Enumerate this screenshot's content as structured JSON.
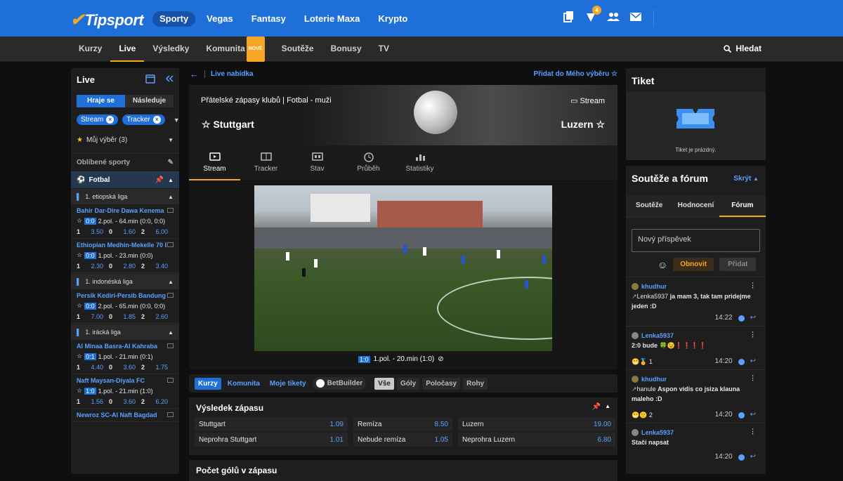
{
  "brand": {
    "name": "Tipsport"
  },
  "mainnav": [
    "Sporty",
    "Vegas",
    "Fantasy",
    "Loterie Maxa",
    "Krypto"
  ],
  "notif_count": "4",
  "subnav": [
    "Kurzy",
    "Live",
    "Výsledky",
    "Komunita",
    "Soutěže",
    "Bonusy",
    "TV"
  ],
  "nove": "NOVÉ",
  "search": "Hledat",
  "left": {
    "title": "Live",
    "seg": [
      "Hraje se",
      "Následuje"
    ],
    "chips": [
      "Stream",
      "Tracker"
    ],
    "muj": "Můj výběr (3)",
    "oblibene": "Oblíbené sporty",
    "sport": "Fotbal",
    "blocks": [
      {
        "league": "1. etiopská liga",
        "matches": [
          {
            "name": "Bahir Dar-Dire Dawa Kenema",
            "score": "0:0",
            "status": "2.pol. - 64.min (0:0, 0:0)",
            "o1": "3.50",
            "o0": "1.60",
            "o2": "6.00"
          },
          {
            "name": "Ethiopian Medhin-Mekelle 70 E...",
            "score": "0:0",
            "status": "1.pol. - 23.min (0:0)",
            "o1": "2.30",
            "o0": "2.80",
            "o2": "3.40"
          }
        ]
      },
      {
        "league": "1. indonéská liga",
        "matches": [
          {
            "name": "Persik Kediri-Persib Bandung",
            "score": "0:0",
            "status": "2.pol. - 65.min (0:0, 0:0)",
            "o1": "7.00",
            "o0": "1.85",
            "o2": "2.60"
          }
        ]
      },
      {
        "league": "1. irácká liga",
        "matches": [
          {
            "name": "Al Minaa Basra-Al Kahraba",
            "score": "0:1",
            "status": "1.pol. - 21.min (0:1)",
            "o1": "4.40",
            "o0": "3.60",
            "o2": "1.75"
          },
          {
            "name": "Naft Maysan-Diyala FC",
            "score": "1:0",
            "status": "1.pol. - 21.min (1:0)",
            "o1": "1.56",
            "o0": "3.60",
            "o2": "6.20"
          },
          {
            "name": "Newroz SC-Al Naft Bagdad",
            "score": "",
            "status": "",
            "o1": "",
            "o0": "",
            "o2": ""
          }
        ]
      }
    ],
    "lbl1": "1",
    "lbl0": "0",
    "lbl2": "2"
  },
  "crumb": {
    "label": "Live nabídka",
    "add": "Přidat do Mého výběru"
  },
  "event": {
    "title": "Přátelské zápasy klubů  |  Fotbal - muži",
    "stream": "Stream",
    "home": "Stuttgart",
    "away": "Luzern"
  },
  "tabs": [
    "Stream",
    "Tracker",
    "Stav",
    "Průběh",
    "Statistiky"
  ],
  "video": {
    "score": "1:0",
    "status": "1.pol. - 20.min (1:0)"
  },
  "betbar": [
    "Kurzy",
    "Komunita",
    "Moje tikety",
    "BetBuilder",
    "Vše",
    "Góly",
    "Poločasy",
    "Rohy"
  ],
  "market": {
    "title": "Výsledek zápasu",
    "cells": [
      [
        "Stuttgart",
        "1.09"
      ],
      [
        "Remíza",
        "8.50"
      ],
      [
        "Luzern",
        "19.00"
      ],
      [
        "Neprohra Stuttgart",
        "1.01"
      ],
      [
        "Nebude remíza",
        "1.05"
      ],
      [
        "Neprohra Luzern",
        "6.80"
      ]
    ]
  },
  "market2": {
    "title": "Počet gólů v zápasu"
  },
  "tiket": {
    "title": "Tiket",
    "empty": "Tiket je prázdný."
  },
  "forum": {
    "title": "Soutěže a fórum",
    "skryt": "Skrýt",
    "tabs": [
      "Soutěže",
      "Hodnocení",
      "Fórum"
    ],
    "placeholder": "Nový příspěvek",
    "obnovit": "Obnovit",
    "pridat": "Přidat",
    "comments": [
      {
        "user": "khudhur",
        "reply": "Lenka5937",
        "text": "ja mam 3, tak tam pridejme jeden :D",
        "time": "14:22",
        "react": ""
      },
      {
        "user": "Lenka5937",
        "reply": "",
        "text": "2:0 bude 🍀😉❗❗❗❗",
        "time": "14:20",
        "react": "1"
      },
      {
        "user": "khudhur",
        "reply": "hanule",
        "text": "Aspon vidis co jsiza klauna maleho :D",
        "time": "14:20",
        "react": "2"
      },
      {
        "user": "Lenka5937",
        "reply": "",
        "text": "Stačí napsat",
        "time": "14:20",
        "react": ""
      }
    ]
  }
}
